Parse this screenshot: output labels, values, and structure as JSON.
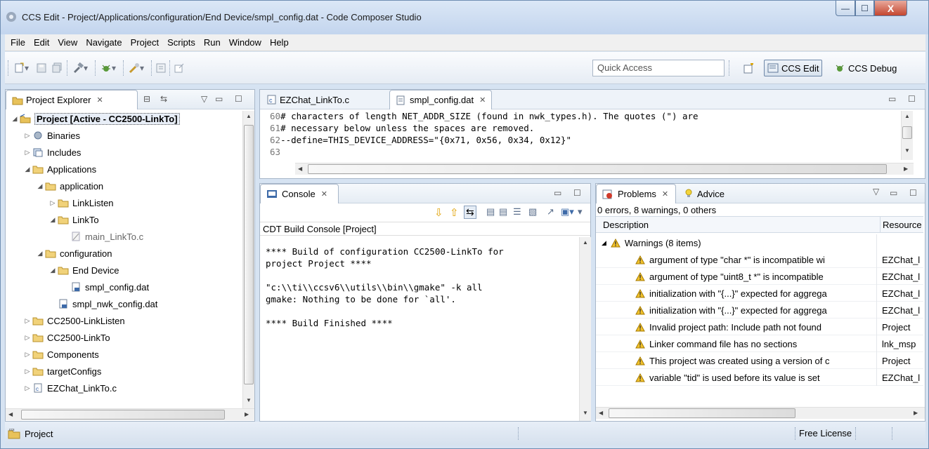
{
  "window": {
    "title": "CCS Edit - Project/Applications/configuration/End Device/smpl_config.dat - Code Composer Studio",
    "minimize_glyph": "—",
    "maximize_glyph": "☐",
    "close_glyph": "X"
  },
  "menu": [
    "File",
    "Edit",
    "View",
    "Navigate",
    "Project",
    "Scripts",
    "Run",
    "Window",
    "Help"
  ],
  "toolbar": {
    "quick_access_placeholder": "Quick Access",
    "perspectives": [
      "CCS Edit",
      "CCS Debug"
    ],
    "icons": [
      "new-icon",
      "save-icon",
      "save-all-icon",
      "build-icon",
      "debug-icon",
      "flash-icon",
      "console-icon",
      "open-perspective-icon"
    ]
  },
  "project_explorer": {
    "tab_label": "Project Explorer",
    "tree": [
      {
        "label": "Project  [Active - CC2500-LinkTo]",
        "depth": 0,
        "expanded": true,
        "icon": "project-icon",
        "bold": true
      },
      {
        "label": "Binaries",
        "depth": 1,
        "expanded": false,
        "icon": "binaries-icon"
      },
      {
        "label": "Includes",
        "depth": 1,
        "expanded": false,
        "icon": "includes-icon"
      },
      {
        "label": "Applications",
        "depth": 1,
        "expanded": true,
        "icon": "folder-icon"
      },
      {
        "label": "application",
        "depth": 2,
        "expanded": true,
        "icon": "folder-icon"
      },
      {
        "label": "LinkListen",
        "depth": 3,
        "expanded": false,
        "icon": "folder-icon"
      },
      {
        "label": "LinkTo",
        "depth": 3,
        "expanded": true,
        "icon": "folder-icon"
      },
      {
        "label": "main_LinkTo.c",
        "depth": 4,
        "icon": "c-file-excluded-icon",
        "muted": true
      },
      {
        "label": "configuration",
        "depth": 2,
        "expanded": true,
        "icon": "folder-icon"
      },
      {
        "label": "End Device",
        "depth": 3,
        "expanded": true,
        "icon": "folder-icon"
      },
      {
        "label": "smpl_config.dat",
        "depth": 4,
        "icon": "dat-file-icon"
      },
      {
        "label": "smpl_nwk_config.dat",
        "depth": 3,
        "icon": "dat-file-icon"
      },
      {
        "label": "CC2500-LinkListen",
        "depth": 1,
        "expanded": false,
        "icon": "folder-icon"
      },
      {
        "label": "CC2500-LinkTo",
        "depth": 1,
        "expanded": false,
        "icon": "folder-icon"
      },
      {
        "label": "Components",
        "depth": 1,
        "expanded": false,
        "icon": "folder-icon"
      },
      {
        "label": "targetConfigs",
        "depth": 1,
        "expanded": false,
        "icon": "folder-icon"
      },
      {
        "label": "EZChat_LinkTo.c",
        "depth": 1,
        "expanded": false,
        "icon": "c-file-icon"
      }
    ]
  },
  "editor": {
    "tabs": [
      {
        "label": "EZChat_LinkTo.c",
        "icon": "c-file-icon",
        "selected": false
      },
      {
        "label": "smpl_config.dat",
        "icon": "dat-file-icon",
        "selected": true
      }
    ],
    "lines": [
      {
        "no": "60",
        "text": "# characters of length NET_ADDR_SIZE (found in nwk_types.h). The quotes (\") are"
      },
      {
        "no": "61",
        "text": "# necessary below unless the spaces are removed."
      },
      {
        "no": "62",
        "text": "--define=THIS_DEVICE_ADDRESS=\"{0x71, 0x56, 0x34, 0x12}\""
      },
      {
        "no": "63",
        "text": ""
      }
    ]
  },
  "console": {
    "tab_label": "Console",
    "subtitle": "CDT Build Console [Project]",
    "lines": [
      "**** Build of configuration CC2500-LinkTo for",
      "project Project ****",
      "",
      "\"c:\\\\ti\\\\ccsv6\\\\utils\\\\bin\\\\gmake\" -k all",
      "gmake: Nothing to be done for `all'.",
      "",
      "**** Build Finished ****"
    ]
  },
  "problems": {
    "tab_label": "Problems",
    "advice_label": "Advice",
    "summary": "0 errors, 8 warnings, 0 others",
    "columns": [
      "Description",
      "Resource"
    ],
    "group": "Warnings (8 items)",
    "rows": [
      {
        "desc": "argument of type \"char *\" is incompatible wi",
        "res": "EZChat_l"
      },
      {
        "desc": "argument of type \"uint8_t *\" is incompatible",
        "res": "EZChat_l"
      },
      {
        "desc": "initialization with \"{...}\" expected for aggrega",
        "res": "EZChat_l"
      },
      {
        "desc": "initialization with \"{...}\" expected for aggrega",
        "res": "EZChat_l"
      },
      {
        "desc": "Invalid project path: Include path not found",
        "res": "Project"
      },
      {
        "desc": "Linker command file has no sections",
        "res": "lnk_msp"
      },
      {
        "desc": "This project was created using a version of c",
        "res": "Project"
      },
      {
        "desc": "variable \"tid\" is used before its value is set",
        "res": "EZChat_l"
      }
    ]
  },
  "status": {
    "project": "Project",
    "license": "Free License"
  }
}
